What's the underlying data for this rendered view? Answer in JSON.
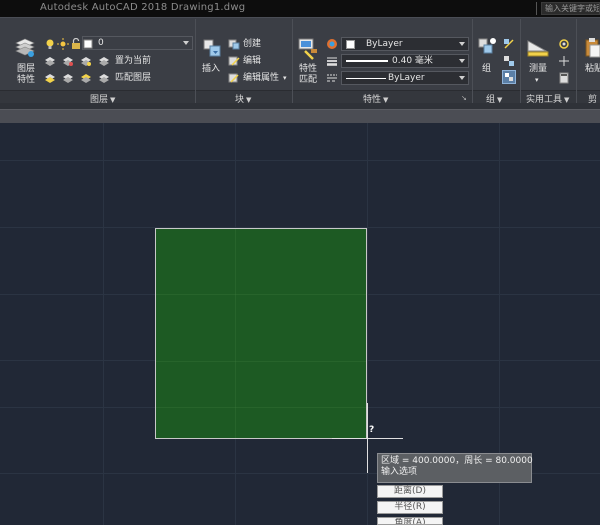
{
  "titlebar": {
    "title": "Autodesk AutoCAD 2018    Drawing1.dwg",
    "search_placeholder": "输入关键字或短语"
  },
  "ribbon": {
    "layers": {
      "layer_props_label": "图层\n特性",
      "layer_props_line1": "图层",
      "layer_props_line2": "特性",
      "layer_dropdown_value": "0",
      "set_current": "置为当前",
      "match_layer": "匹配图层",
      "panel_title": "图层"
    },
    "block": {
      "insert": "插入",
      "create": "创建",
      "edit": "编辑",
      "edit_attrs": "编辑属性",
      "panel_title": "块"
    },
    "properties": {
      "match_line1": "特性",
      "match_line2": "匹配",
      "color_value": "ByLayer",
      "lineweight_value": "0.40 毫米",
      "linetype_value": "ByLayer",
      "panel_title": "特性"
    },
    "groups": {
      "group": "组",
      "panel_title": "组"
    },
    "utilities": {
      "measure": "测量",
      "panel_title": "实用工具"
    },
    "clipboard": {
      "paste": "粘贴",
      "panel_title": "剪"
    }
  },
  "canvas": {
    "cursor_mark": "?",
    "tooltip_line1": "区域 = 400.0000，周长 = 80.0000",
    "tooltip_line2": "输入选项",
    "options": [
      "距离(D)",
      "半径(R)",
      "角度(A)"
    ]
  },
  "colors": {
    "accent_green": "#1d5a23",
    "canvas_bg": "#212836",
    "ribbon_bg": "#3b3e45"
  }
}
